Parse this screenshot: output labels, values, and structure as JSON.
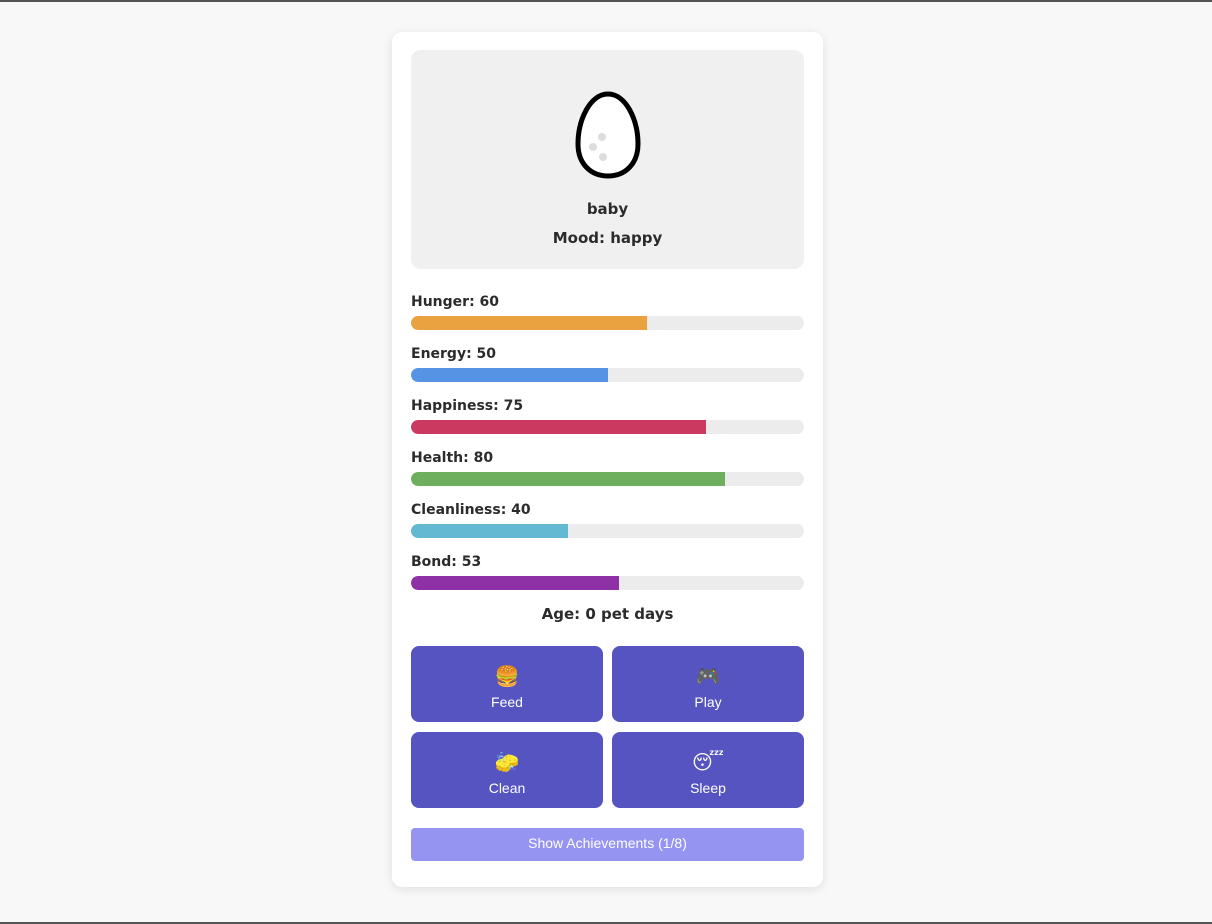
{
  "pet": {
    "stage": "baby",
    "mood": "Mood: happy"
  },
  "stats": [
    {
      "label": "Hunger: 60",
      "value": 60,
      "color": "#eaa13f"
    },
    {
      "label": "Energy: 50",
      "value": 50,
      "color": "#5693e4"
    },
    {
      "label": "Happiness: 75",
      "value": 75,
      "color": "#cc3960"
    },
    {
      "label": "Health: 80",
      "value": 80,
      "color": "#6daf5e"
    },
    {
      "label": "Cleanliness: 40",
      "value": 40,
      "color": "#63b9d1"
    },
    {
      "label": "Bond: 53",
      "value": 53,
      "color": "#8e31a6"
    }
  ],
  "age": "Age: 0 pet days",
  "actions": [
    {
      "emoji": "🍔",
      "label": "Feed",
      "icon": "burger-icon"
    },
    {
      "emoji": "🎮",
      "label": "Play",
      "icon": "gamepad-icon"
    },
    {
      "emoji": "🧽",
      "label": "Clean",
      "icon": "sponge-icon"
    },
    {
      "emoji": "😴",
      "label": "Sleep",
      "icon": "sleeping-face-icon"
    }
  ],
  "achievements_button": "Show Achievements (1/8)",
  "colors": {
    "button": "#5654c0",
    "achievements_button": "#9594f0"
  }
}
